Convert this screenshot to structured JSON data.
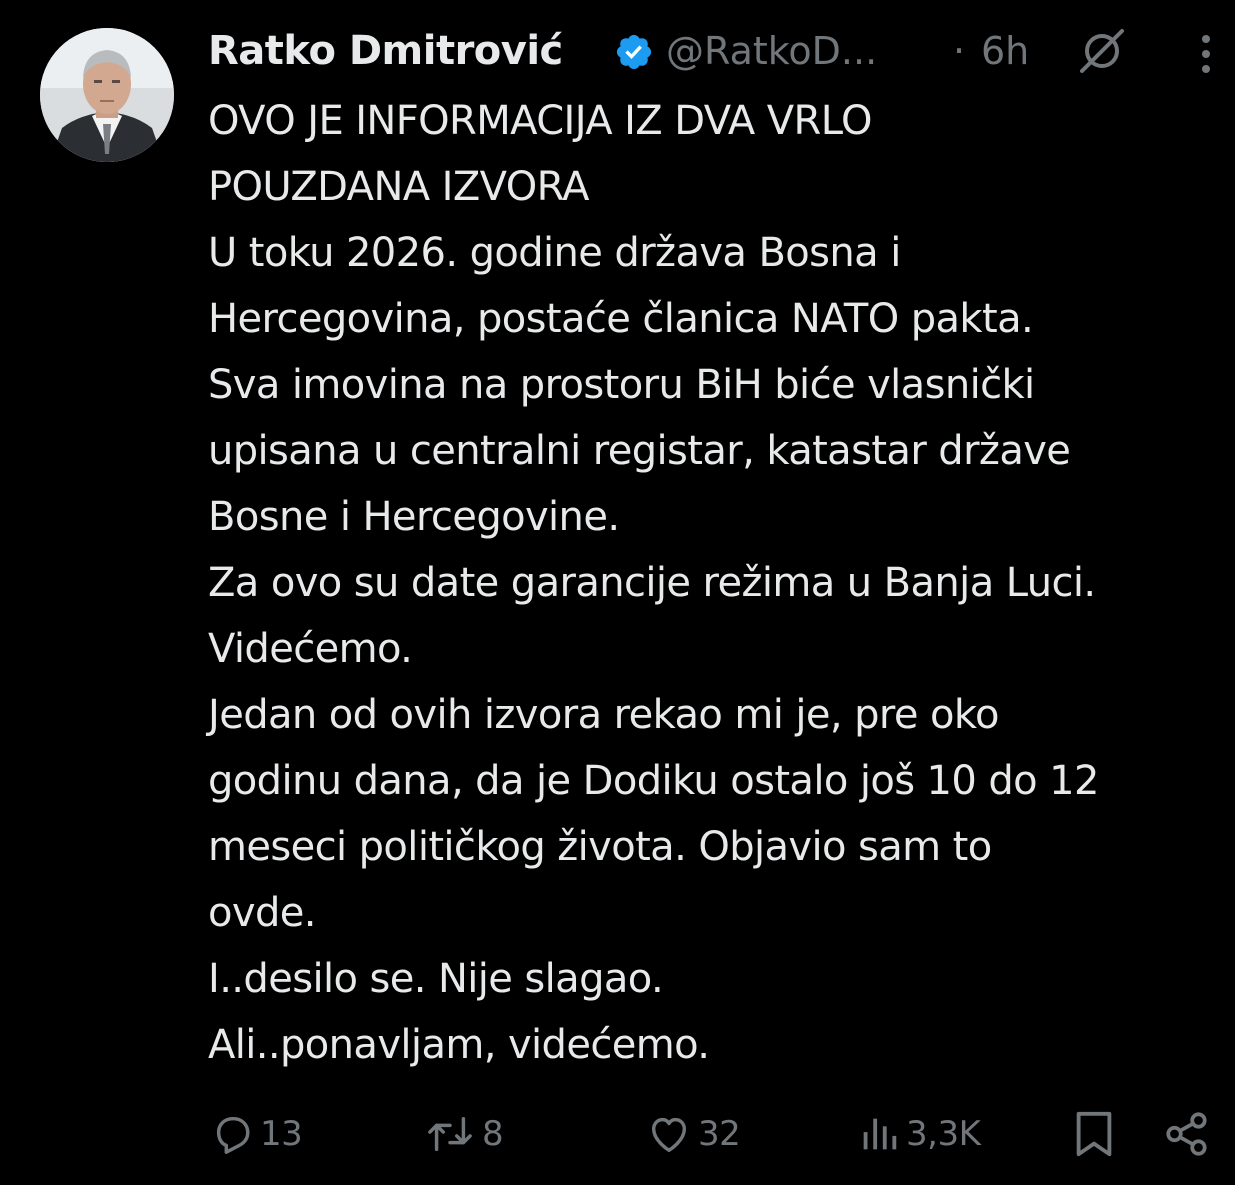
{
  "post": {
    "author": {
      "display_name": "Ratko Dmitrović",
      "handle": "@RatkoD...",
      "verified": true,
      "avatar_icon": "profile-photo"
    },
    "separator": "·",
    "time": "6h",
    "text_lines": [
      "OVO JE INFORMACIJA IZ DVA VRLO",
      "POUZDANA IZVORA",
      "U toku 2026. godine država Bosna i",
      "Hercegovina, postaće članica NATO pakta.",
      "Sva imovina na prostoru BiH biće vlasnički",
      "upisana u centralni registar, katastar države",
      "Bosne i Hercegovine.",
      "Za ovo su date garancije režima u Banja Luci.",
      "Videćemo.",
      "Jedan od ovih izvora rekao mi je, pre oko",
      "godinu dana, da je Dodiku ostalo još 10 do 12",
      "meseci političkog života. Objavio sam to",
      "ovde.",
      "I..desilo se. Nije slagao.",
      "Ali..ponavljam, videćemo."
    ],
    "stats": {
      "replies": "13",
      "reposts": "8",
      "likes": "32",
      "views": "3,3K"
    }
  },
  "colors": {
    "background": "#000000",
    "primary_text": "#e7e9ea",
    "secondary_text": "#71767b",
    "verified_badge": "#1d9bf0"
  },
  "icons": {
    "verified": "verified-badge-icon",
    "grok": "grok-icon",
    "more": "more-vertical-icon",
    "reply": "reply-icon",
    "repost": "repost-icon",
    "like": "heart-icon",
    "views": "views-bar-chart-icon",
    "bookmark": "bookmark-icon",
    "share": "share-icon"
  }
}
